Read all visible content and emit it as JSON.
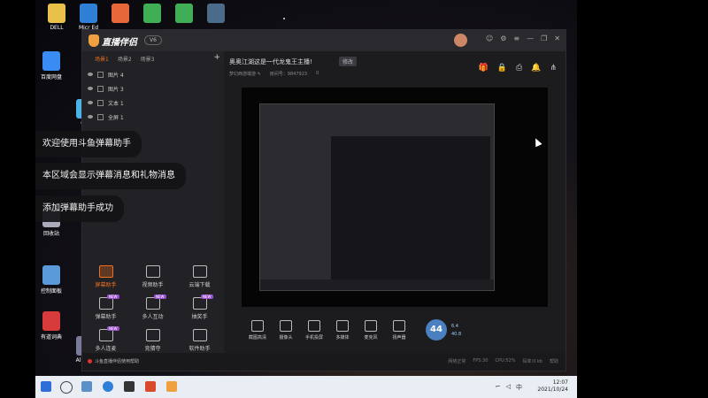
{
  "desktop": {
    "icons": [
      {
        "label": "DELL",
        "color": "#e8c04a"
      },
      {
        "label": "Micr\nEd",
        "color": "#2f7fd6"
      },
      {
        "label": "",
        "color": "#e7663a"
      },
      {
        "label": "",
        "color": "#3fae55"
      },
      {
        "label": "",
        "color": "#3fae55"
      },
      {
        "label": "",
        "color": "#4a6c8a"
      }
    ],
    "left_icons": [
      {
        "label": "百度网盘",
        "color": "#3b8bf5"
      },
      {
        "label": "QQ",
        "color": "#4ab3e8"
      },
      {
        "label": "回收站",
        "color": "#aab"
      },
      {
        "label": "控制面板",
        "color": "#5a9ad8"
      },
      {
        "label": "有道词典",
        "color": "#d63a3a"
      },
      {
        "label": "Al\nDesi",
        "color": "#7a7a9a"
      }
    ]
  },
  "toasts": [
    "欢迎使用斗鱼弹幕助手",
    "本区域会显示弹幕消息和礼物消息",
    "添加弹幕助手成功"
  ],
  "app": {
    "name": "直播伴侣",
    "version": "V6",
    "scene_tabs": [
      "场景1",
      "场景2",
      "场景3"
    ],
    "sources": [
      "图片 4",
      "图片 3",
      "文本 1",
      "全屏 1"
    ],
    "room_title": "奥奥江湖这是一代龙鬼王主播!",
    "room_tag": "修改",
    "room_meta": [
      "梦幻西游端游 ✎",
      "房间号：9847923",
      "0"
    ],
    "tools": [
      [
        {
          "label": "屏幕助手",
          "accent": true,
          "badge": ""
        },
        {
          "label": "视频助手",
          "accent": false,
          "badge": ""
        },
        {
          "label": "云端下载",
          "accent": false,
          "badge": ""
        }
      ],
      [
        {
          "label": "弹幕助手",
          "accent": false,
          "badge": "NEW"
        },
        {
          "label": "多人互动",
          "accent": false,
          "badge": "NEW"
        },
        {
          "label": "抽奖手",
          "accent": false,
          "badge": "NEW"
        }
      ],
      [
        {
          "label": "多人连麦",
          "accent": false,
          "badge": "NEW"
        },
        {
          "label": "竞猜夺",
          "accent": false,
          "badge": ""
        },
        {
          "label": "软件助手",
          "accent": false,
          "badge": ""
        }
      ]
    ],
    "bottom_tools": [
      "截图高清",
      "摄像头",
      "手机投屏",
      "多媒体",
      "麦克风",
      "扬声器"
    ],
    "speed": "44",
    "speed_up": "6.4",
    "speed_down": "40.8",
    "status_left": "斗鱼直播伴侣使用帮助",
    "status_right": [
      "网络正常",
      "FPS:30",
      "CPU:52%",
      "码率:0 kb",
      "帮助"
    ]
  },
  "taskbar": {
    "time": "12:07",
    "date": "2021/10/24",
    "lang": "中"
  },
  "colors": {
    "accent": "#f07020",
    "badge": "#9a4fd0"
  }
}
